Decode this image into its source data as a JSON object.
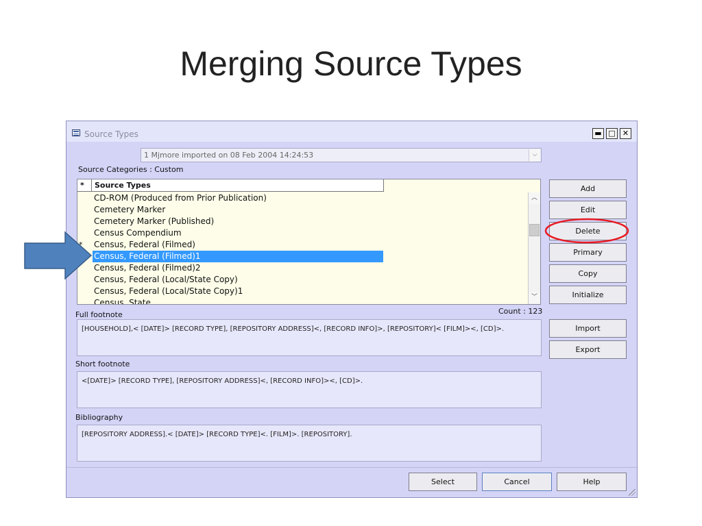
{
  "slide": {
    "title": "Merging Source Types"
  },
  "window": {
    "title": "Source Types",
    "buttons": {
      "minimize": "▬",
      "restore": "□",
      "close": "✕"
    }
  },
  "import_combo": {
    "value": "1 Mjmore imported on 08 Feb 2004 14:24:53",
    "arrow": "⌵"
  },
  "categories_label": "Source Categories : Custom",
  "list": {
    "header_star": "*",
    "header_name": "Source Types",
    "rows": [
      {
        "star": "",
        "name": "CD-ROM (Produced from Prior Publication)"
      },
      {
        "star": "",
        "name": "Cemetery Marker"
      },
      {
        "star": "",
        "name": "Cemetery Marker (Published)"
      },
      {
        "star": "",
        "name": "Census Compendium"
      },
      {
        "star": "*",
        "name": "Census, Federal (Filmed)"
      },
      {
        "star": "",
        "name": "Census, Federal (Filmed)1"
      },
      {
        "star": "",
        "name": "Census, Federal (Filmed)2"
      },
      {
        "star": "",
        "name": "Census, Federal (Local/State Copy)"
      },
      {
        "star": "",
        "name": "Census, Federal (Local/State Copy)1"
      },
      {
        "star": "",
        "name": "Census, State"
      }
    ],
    "selected_index": 5,
    "scroll_up": "︿",
    "scroll_down": "﹀"
  },
  "count_label": "Count : 123",
  "full_footnote": {
    "label": "Full footnote",
    "value": "[HOUSEHOLD],< [DATE]> [RECORD TYPE], [REPOSITORY ADDRESS]<, [RECORD INFO]>, [REPOSITORY]< [FILM]><, [CD]>."
  },
  "short_footnote": {
    "label": "Short footnote",
    "value": "<[DATE]> [RECORD TYPE], [REPOSITORY ADDRESS]<, [RECORD INFO]><, [CD]>."
  },
  "bibliography": {
    "label": "Bibliography",
    "value": "[REPOSITORY ADDRESS].< [DATE]> [RECORD TYPE]<. [FILM]>. [REPOSITORY]."
  },
  "side_buttons": {
    "add": "Add",
    "edit": "Edit",
    "delete": "Delete",
    "primary": "Primary",
    "copy": "Copy",
    "initialize": "Initialize",
    "import": "Import",
    "export": "Export"
  },
  "bottom_buttons": {
    "select": "Select",
    "cancel": "Cancel",
    "help": "Help"
  },
  "annotations": {
    "arrow_color": "#4f81bd",
    "circle_color": "#e81b23"
  }
}
